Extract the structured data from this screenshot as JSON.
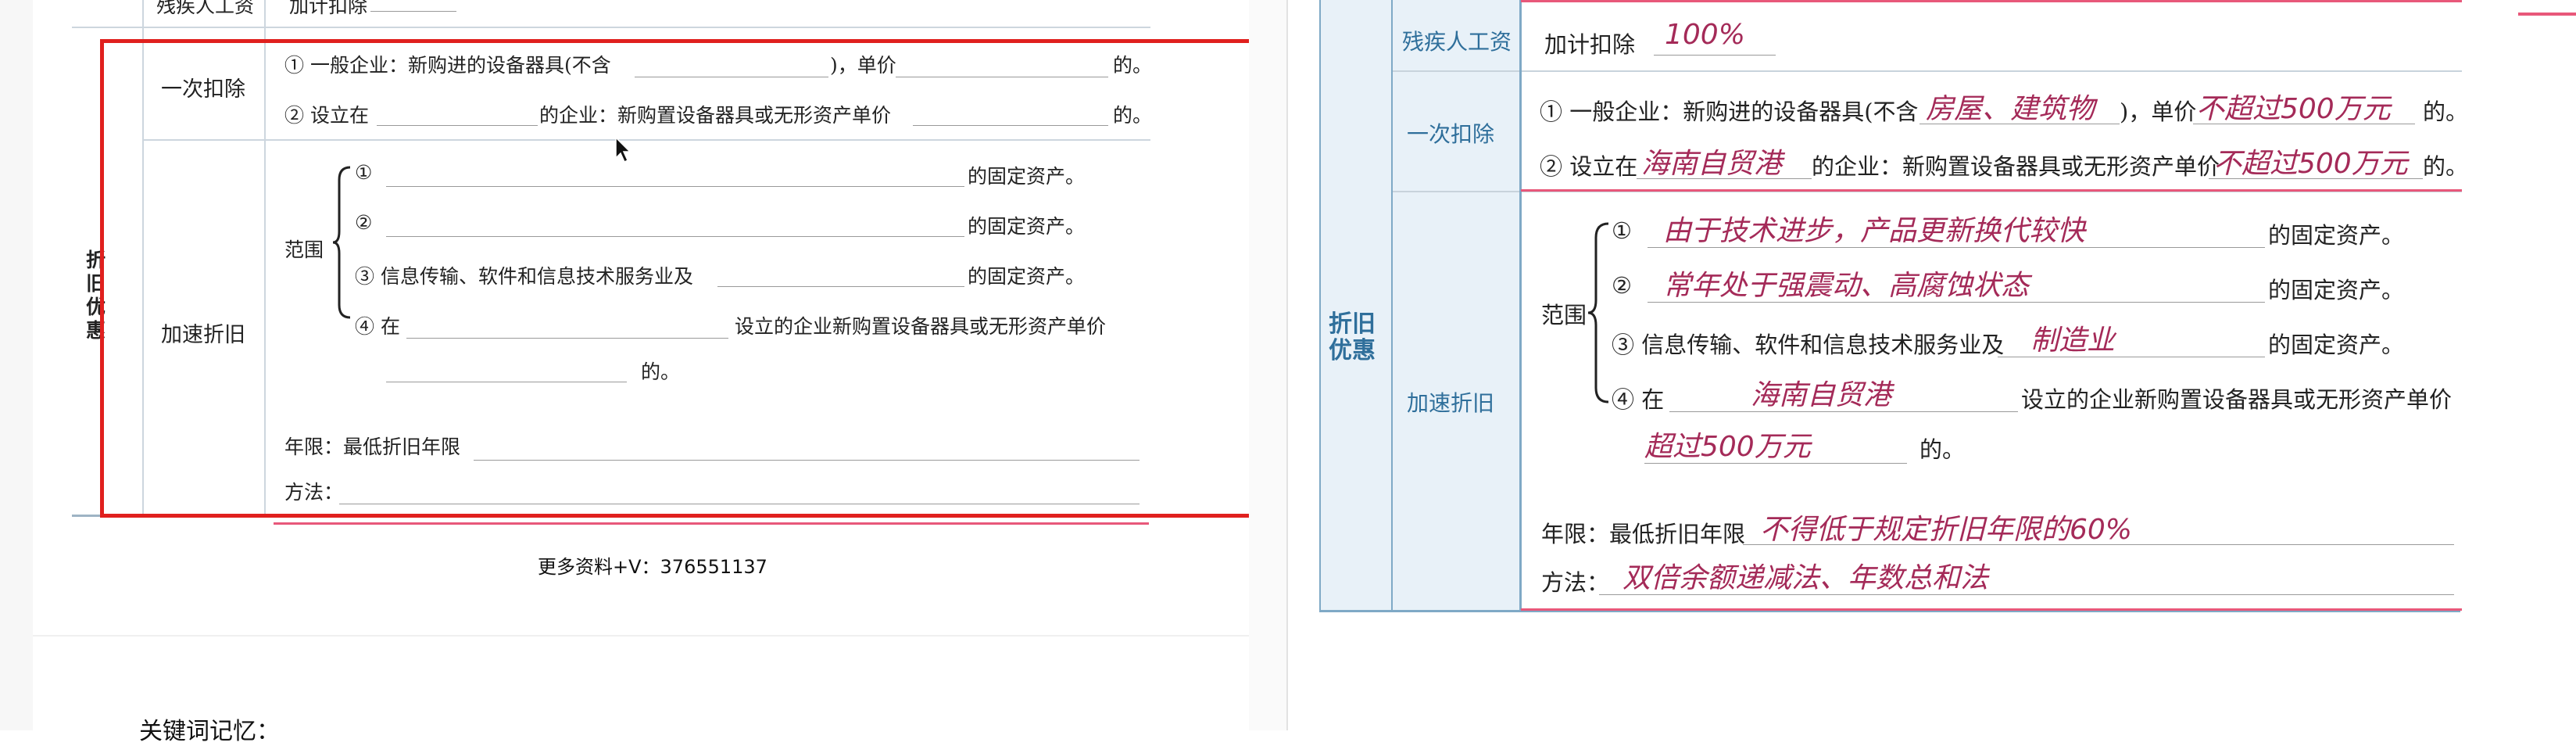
{
  "left_doc": {
    "top_row": {
      "label": "残疾人工资",
      "text": "加计扣除"
    },
    "category": "折旧优惠",
    "once": {
      "label": "一次扣除",
      "line1_a": "① 一般企业：新购进的设备器具(不含",
      "line1_b": ")，单价",
      "line1_c": "的。",
      "line2_a": "② 设立在",
      "line2_b": "的企业：新购置设备器具或无形资产单价",
      "line2_c": "的。"
    },
    "accel": {
      "label": "加速折旧",
      "scope": "范围",
      "item1": "①",
      "item1_end": "的固定资产。",
      "item2": "②",
      "item2_end": "的固定资产。",
      "item3": "③ 信息传输、软件和信息技术服务业及",
      "item3_end": "的固定资产。",
      "item4_a": "④ 在",
      "item4_b": "设立的企业新购置设备器具或无形资产单价",
      "item4_end": "的。",
      "term": "年限：最低折旧年限",
      "method": "方法："
    },
    "footer": "更多资料+V：376551137",
    "keywords": "关键词记忆："
  },
  "right_doc": {
    "top_row": {
      "label": "残疾人工资",
      "text": "加计扣除",
      "hw": "100%"
    },
    "category": "折旧优惠",
    "once": {
      "label": "一次扣除",
      "line1_a": "① 一般企业：新购进的设备器具(不含",
      "line1_hw": "房屋、建筑物",
      "line1_b": ")，单价",
      "line1_hw2": "不超过500万元",
      "line1_c": "的。",
      "line2_a": "② 设立在",
      "line2_hw": "海南自贸港",
      "line2_b": "的企业：新购置设备器具或无形资产单价",
      "line2_hw2": "不超过500万元",
      "line2_c": "的。"
    },
    "accel": {
      "label": "加速折旧",
      "scope": "范围",
      "item1": "①",
      "item1_hw": "由于技术进步，产品更新换代较快",
      "item1_end": "的固定资产。",
      "item2": "②",
      "item2_hw": "常年处于强震动、高腐蚀状态",
      "item2_end": "的固定资产。",
      "item3": "③ 信息传输、软件和信息技术服务业及",
      "item3_hw": "制造业",
      "item3_end": "的固定资产。",
      "item4_a": "④ 在",
      "item4_hw": "海南自贸港",
      "item4_b": "设立的企业新购置设备器具或无形资产单价",
      "item4_hw2": "超过500万元",
      "item4_end": "的。",
      "term": "年限：最低折旧年限",
      "term_hw": "不得低于规定折旧年限的60%",
      "method": "方法：",
      "method_hw": "双倍余额递减法、年数总和法"
    }
  }
}
